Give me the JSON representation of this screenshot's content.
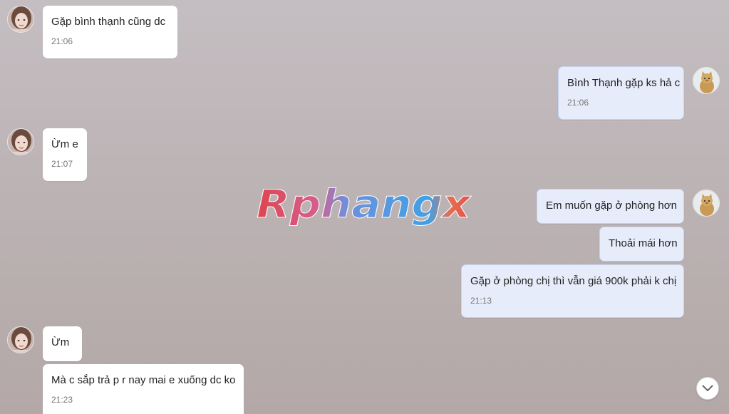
{
  "watermark": "Rphangx",
  "messages": [
    {
      "side": "in",
      "text": "Gặp bình thạnh cũng dc",
      "time": "21:06"
    },
    {
      "side": "out",
      "text": "Bình Thạnh gặp ks hả c",
      "time": "21:06"
    },
    {
      "side": "in",
      "text": "Ừm e",
      "time": "21:07"
    },
    {
      "side": "out",
      "text": "Em muốn gặp ở phòng hơn",
      "time": ""
    },
    {
      "side": "out",
      "text": "Thoải mái hơn",
      "time": ""
    },
    {
      "side": "out",
      "text": "Gặp ở phòng chị thì vẫn giá 900k phải k chị",
      "time": "21:13"
    },
    {
      "side": "in",
      "text": "Ừm",
      "time": ""
    },
    {
      "side": "in",
      "text": "Mà c sắp trả p r nay mai e xuống dc ko",
      "time": "21:23"
    }
  ],
  "icons": {
    "incoming_avatar": "woman-avatar",
    "outgoing_avatar": "cat-avatar",
    "scroll_down": "chevron-down-icon"
  },
  "colors": {
    "incoming_bubble": "#ffffff",
    "outgoing_bubble": "#e6ecfa",
    "outgoing_border": "#c7d3f0"
  }
}
